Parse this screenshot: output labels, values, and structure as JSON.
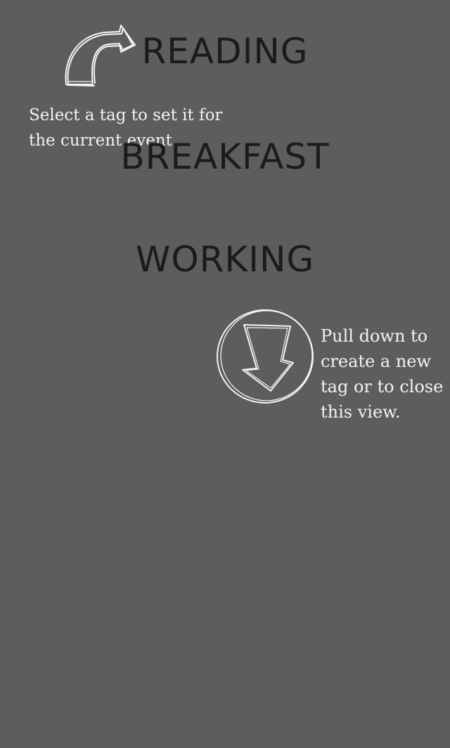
{
  "tags": [
    {
      "label": "READING"
    },
    {
      "label": "BREAKFAST"
    },
    {
      "label": "WORKING"
    }
  ],
  "hints": {
    "select_tag": "Select a tag to set it for the current event",
    "pull_down": "Pull down to create a new tag or to close this view."
  },
  "icons": {
    "curved_arrow": "curved-arrow-icon",
    "pull_down_arrow": "circled-down-arrow-icon"
  },
  "colors": {
    "background": "#5e5d5b",
    "tag_text": "#1b1b1b",
    "hint_text": "#f2f2f2"
  }
}
